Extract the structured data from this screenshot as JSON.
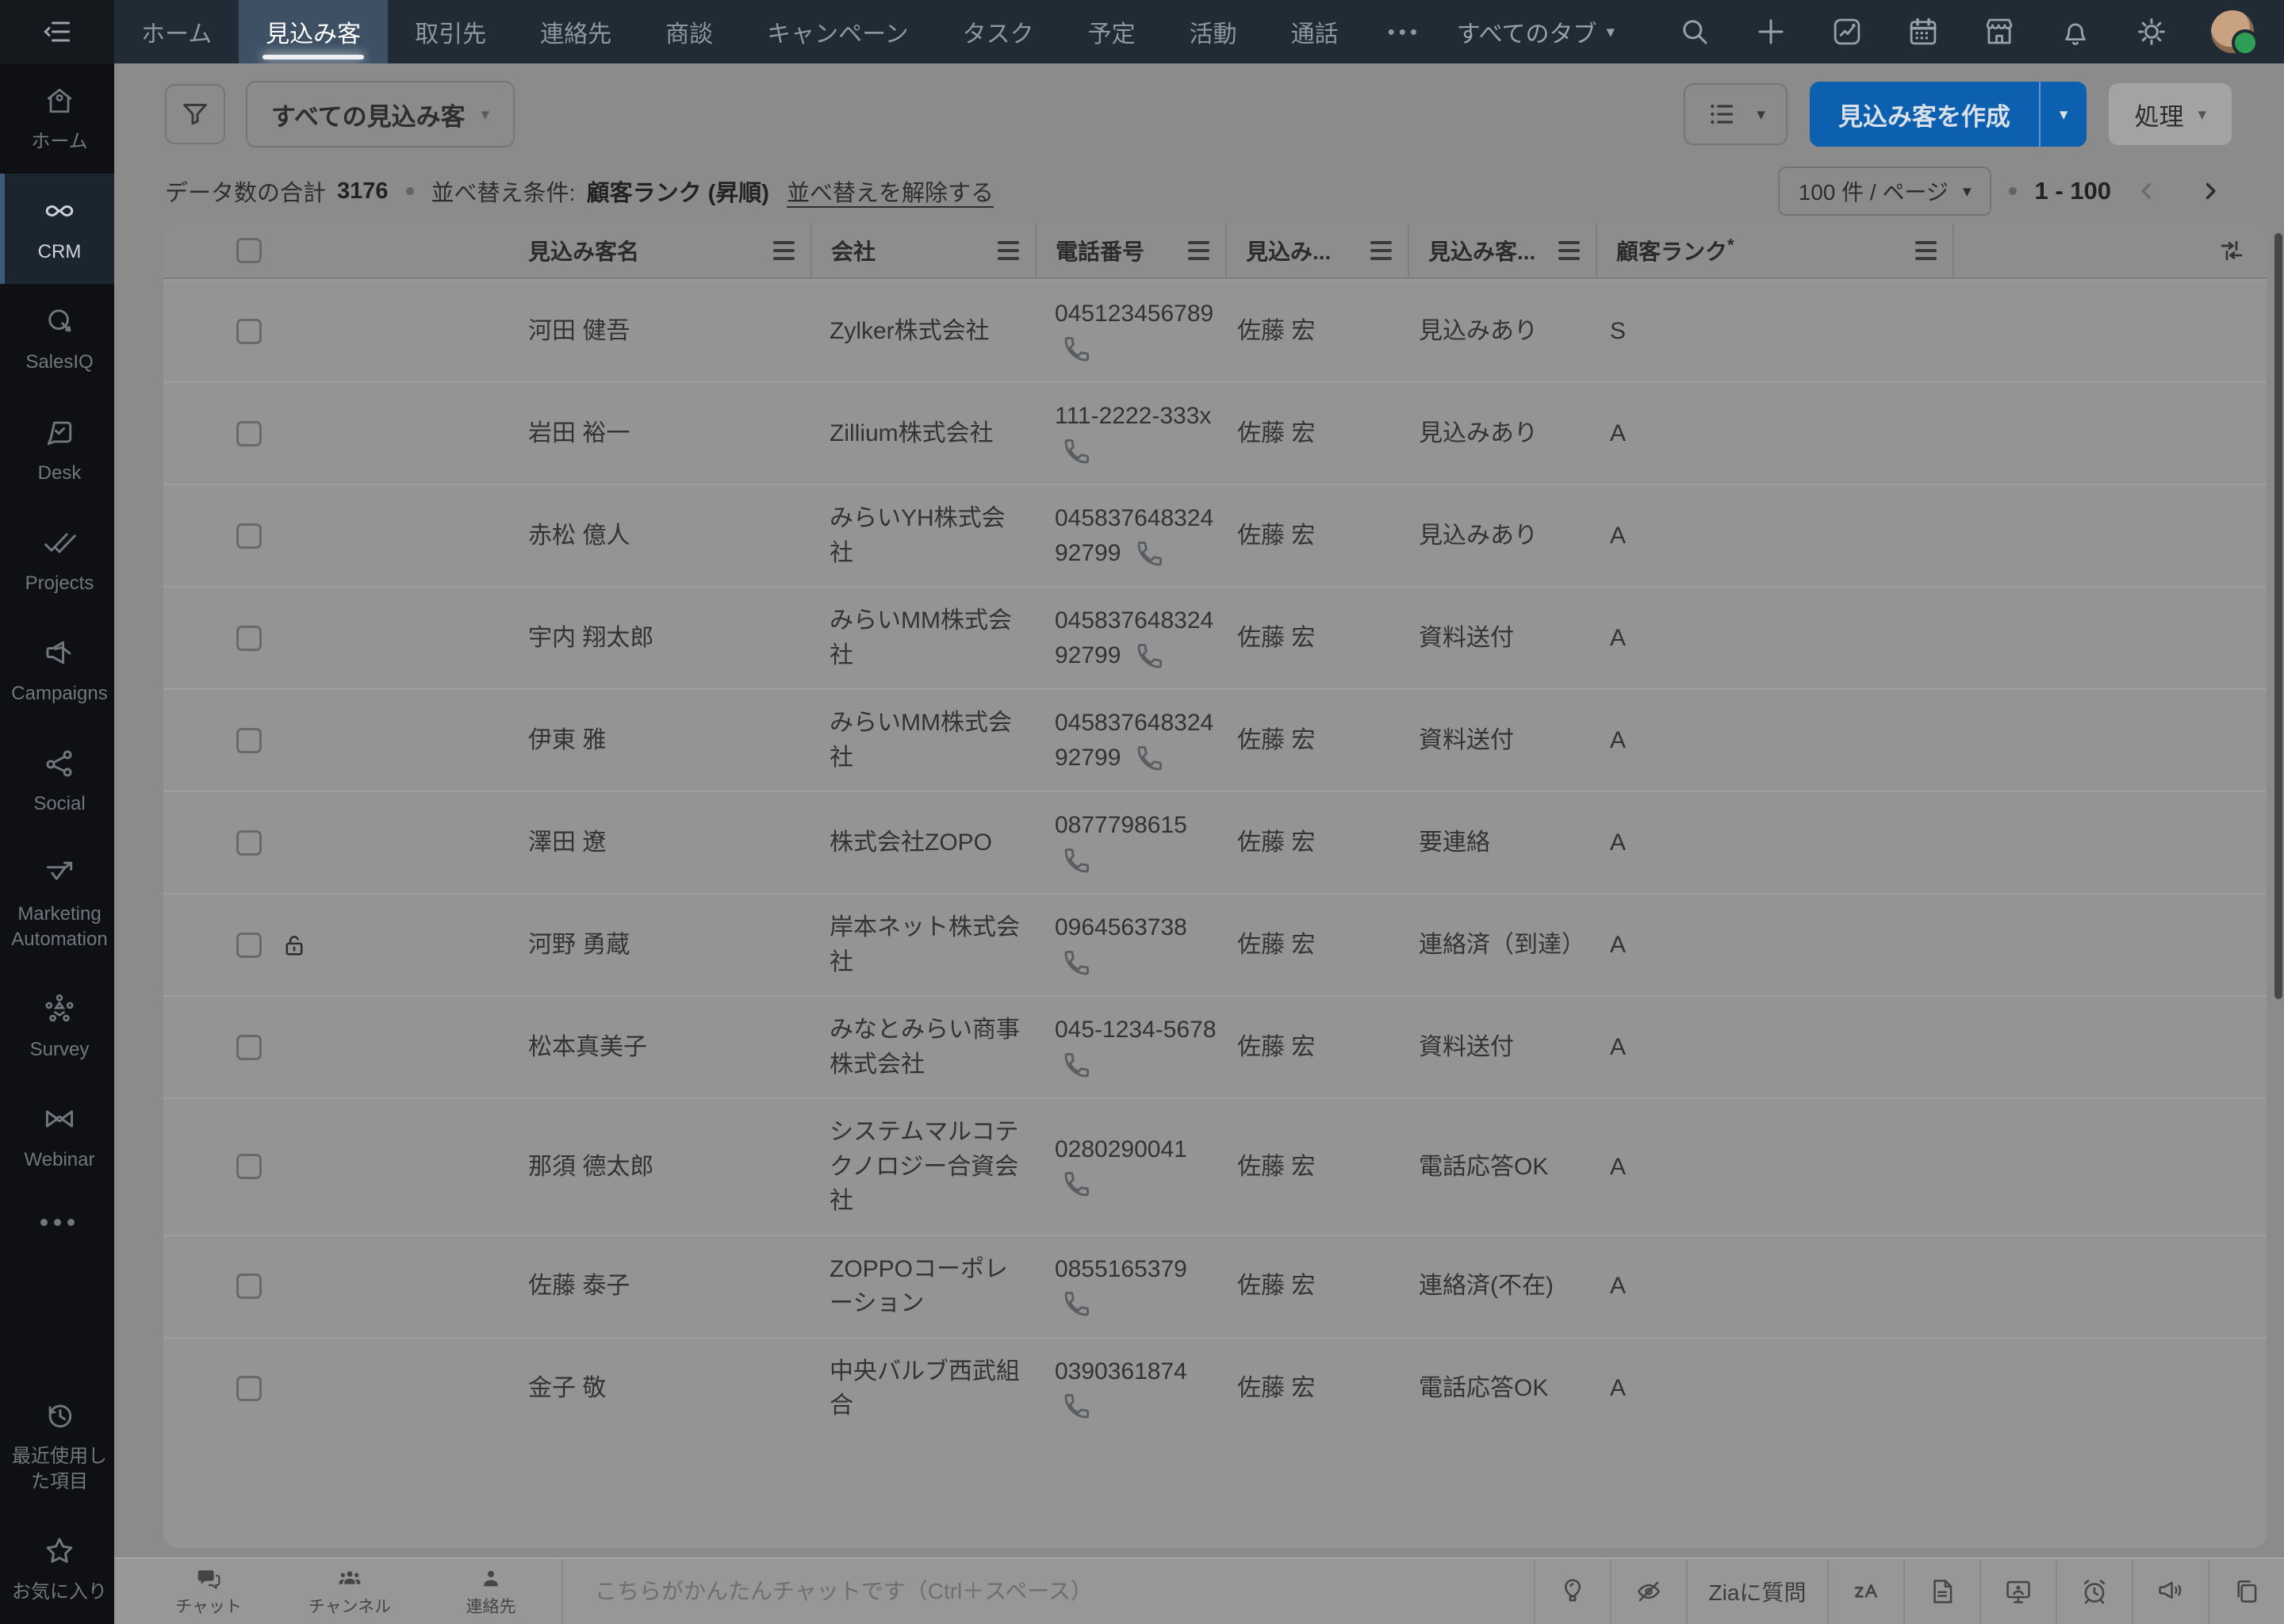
{
  "colors": {
    "accent_button": "#0d5fb0",
    "topnav_bg": "#202b36",
    "sidebar_bg": "#0e1013",
    "active_tab_bg": "#3d5064"
  },
  "topnav": {
    "tabs": [
      {
        "label": "ホーム",
        "active": false
      },
      {
        "label": "見込み客",
        "active": true
      },
      {
        "label": "取引先",
        "active": false
      },
      {
        "label": "連絡先",
        "active": false
      },
      {
        "label": "商談",
        "active": false
      },
      {
        "label": "キャンペーン",
        "active": false
      },
      {
        "label": "タスク",
        "active": false
      },
      {
        "label": "予定",
        "active": false
      },
      {
        "label": "活動",
        "active": false
      },
      {
        "label": "通話",
        "active": false
      }
    ],
    "more_label": "•••",
    "all_tabs_label": "すべてのタブ"
  },
  "sidebar": {
    "items": [
      {
        "label": "ホーム"
      },
      {
        "label": "CRM",
        "active": true
      },
      {
        "label": "SalesIQ"
      },
      {
        "label": "Desk"
      },
      {
        "label": "Projects"
      },
      {
        "label": "Campaigns"
      },
      {
        "label": "Social"
      },
      {
        "label": "Marketing Automation"
      },
      {
        "label": "Survey"
      },
      {
        "label": "Webinar"
      }
    ],
    "bottom_items": [
      {
        "label": "最近使用した項目"
      },
      {
        "label": "お気に入り"
      }
    ]
  },
  "toolbar": {
    "view_selector": "すべての見込み客",
    "create_label": "見込み客を作成",
    "process_label": "処理"
  },
  "list_meta": {
    "total_label": "データ数の合計",
    "total_value": "3176",
    "sort_label": "並べ替え条件:",
    "sort_value": "顧客ランク (昇順)",
    "clear_sort_label": "並べ替えを解除する",
    "per_page": "100 件 / ページ",
    "range": "1 - 100"
  },
  "table": {
    "columns": [
      {
        "label": "見込み客名"
      },
      {
        "label": "会社"
      },
      {
        "label": "電話番号"
      },
      {
        "label": "見込み..."
      },
      {
        "label": "見込み客..."
      },
      {
        "label": "顧客ランク",
        "required_mark": "*"
      }
    ],
    "rows": [
      {
        "name": "河田 健吾",
        "company": "Zylker株式会社",
        "phone": "045123456789",
        "owner": "佐藤 宏",
        "status": "見込みあり",
        "rank": "S",
        "locked": false
      },
      {
        "name": "岩田 裕一",
        "company": "Zillium株式会社",
        "phone": "111-2222-333x",
        "owner": "佐藤 宏",
        "status": "見込みあり",
        "rank": "A",
        "locked": false
      },
      {
        "name": "赤松 億人",
        "company": "みらいYH株式会社",
        "phone": "04583764832492799",
        "owner": "佐藤 宏",
        "status": "見込みあり",
        "rank": "A",
        "locked": false
      },
      {
        "name": "宇内 翔太郎",
        "company": "みらいMM株式会社",
        "phone": "04583764832492799",
        "owner": "佐藤 宏",
        "status": "資料送付",
        "rank": "A",
        "locked": false
      },
      {
        "name": "伊東 雅",
        "company": "みらいMM株式会社",
        "phone": "04583764832492799",
        "owner": "佐藤 宏",
        "status": "資料送付",
        "rank": "A",
        "locked": false
      },
      {
        "name": "澤田 遼",
        "company": "株式会社ZOPO",
        "phone": "0877798615",
        "owner": "佐藤 宏",
        "status": "要連絡",
        "rank": "A",
        "locked": false
      },
      {
        "name": "河野 勇蔵",
        "company": "岸本ネット株式会社",
        "phone": "0964563738",
        "owner": "佐藤 宏",
        "status": "連絡済（到達）",
        "rank": "A",
        "locked": true
      },
      {
        "name": "松本真美子",
        "company": "みなとみらい商事株式会社",
        "phone": "045-1234-5678",
        "owner": "佐藤 宏",
        "status": "資料送付",
        "rank": "A",
        "locked": false
      },
      {
        "name": "那須 德太郎",
        "company": "システムマルコテクノロジー合資会社",
        "phone": "0280290041",
        "owner": "佐藤 宏",
        "status": "電話応答OK",
        "rank": "A",
        "locked": false
      },
      {
        "name": "佐藤 泰子",
        "company": "ZOPPOコーポレーション",
        "phone": "0855165379",
        "owner": "佐藤 宏",
        "status": "連絡済(不在)",
        "rank": "A",
        "locked": false
      },
      {
        "name": "金子 敬",
        "company": "中央バルブ西武組合",
        "phone": "0390361874",
        "owner": "佐藤 宏",
        "status": "電話応答OK",
        "rank": "A",
        "locked": false
      }
    ]
  },
  "bottombar": {
    "tabs": [
      {
        "label": "チャット"
      },
      {
        "label": "チャンネル"
      },
      {
        "label": "連絡先"
      }
    ],
    "chat_placeholder": "こちらがかんたんチャットです（Ctrl＋スペース）",
    "zia_ask_label": "Ziaに質問"
  }
}
